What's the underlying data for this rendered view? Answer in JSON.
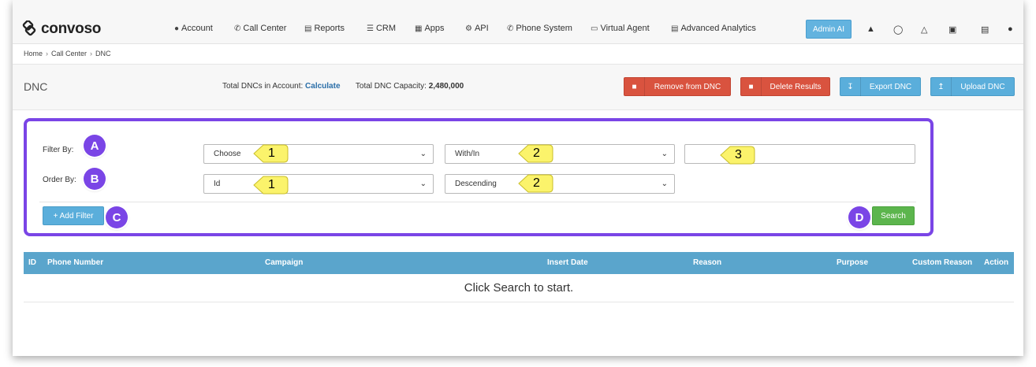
{
  "brand": {
    "name": "convoso"
  },
  "nav": [
    {
      "icon": "user-icon",
      "glyph": "👤",
      "label": "Account"
    },
    {
      "icon": "phone-icon",
      "glyph": "📞",
      "label": "Call Center"
    },
    {
      "icon": "bar-chart-icon",
      "glyph": "📊",
      "label": "Reports"
    },
    {
      "icon": "list-icon",
      "glyph": "☰",
      "label": "CRM"
    },
    {
      "icon": "grid-icon",
      "glyph": "▦",
      "label": "Apps"
    },
    {
      "icon": "gear-icon",
      "glyph": "⚙",
      "label": "API"
    },
    {
      "icon": "phone-icon",
      "glyph": "📞",
      "label": "Phone System"
    },
    {
      "icon": "monitor-icon",
      "glyph": "🖥",
      "label": "Virtual Agent"
    },
    {
      "icon": "bar-chart-icon",
      "glyph": "📊",
      "label": "Advanced Analytics"
    }
  ],
  "admin_ai": "Admin AI",
  "breadcrumb": [
    "Home",
    "Call Center",
    "DNC"
  ],
  "header": {
    "title": "DNC",
    "total_label": "Total DNCs in Account:",
    "calculate": "Calculate",
    "capacity_label": "Total DNC Capacity:",
    "capacity_value": "2,480,000",
    "buttons": {
      "remove": "Remove from DNC",
      "delete": "Delete Results",
      "export": "Export DNC",
      "upload": "Upload DNC"
    }
  },
  "filter": {
    "filter_by_label": "Filter By:",
    "order_by_label": "Order By:",
    "filter_field": "Choose",
    "filter_operator": "With/In",
    "filter_value": "",
    "order_field": "Id",
    "order_direction": "Descending",
    "add_filter": "+ Add Filter",
    "search": "Search"
  },
  "annotations": {
    "a": "A",
    "b": "B",
    "c": "C",
    "d": "D",
    "n1": "1",
    "n2": "2",
    "n3": "3"
  },
  "table": {
    "columns": [
      "ID",
      "Phone Number",
      "Campaign",
      "Insert Date",
      "Reason",
      "Purpose",
      "Custom Reason",
      "Action"
    ],
    "empty_message": "Click Search to start."
  },
  "colors": {
    "accent_purple": "#7a45e6",
    "button_blue": "#5aaedb",
    "button_red": "#d9533f",
    "button_green": "#5cb54d",
    "table_header": "#5aa5cc"
  }
}
